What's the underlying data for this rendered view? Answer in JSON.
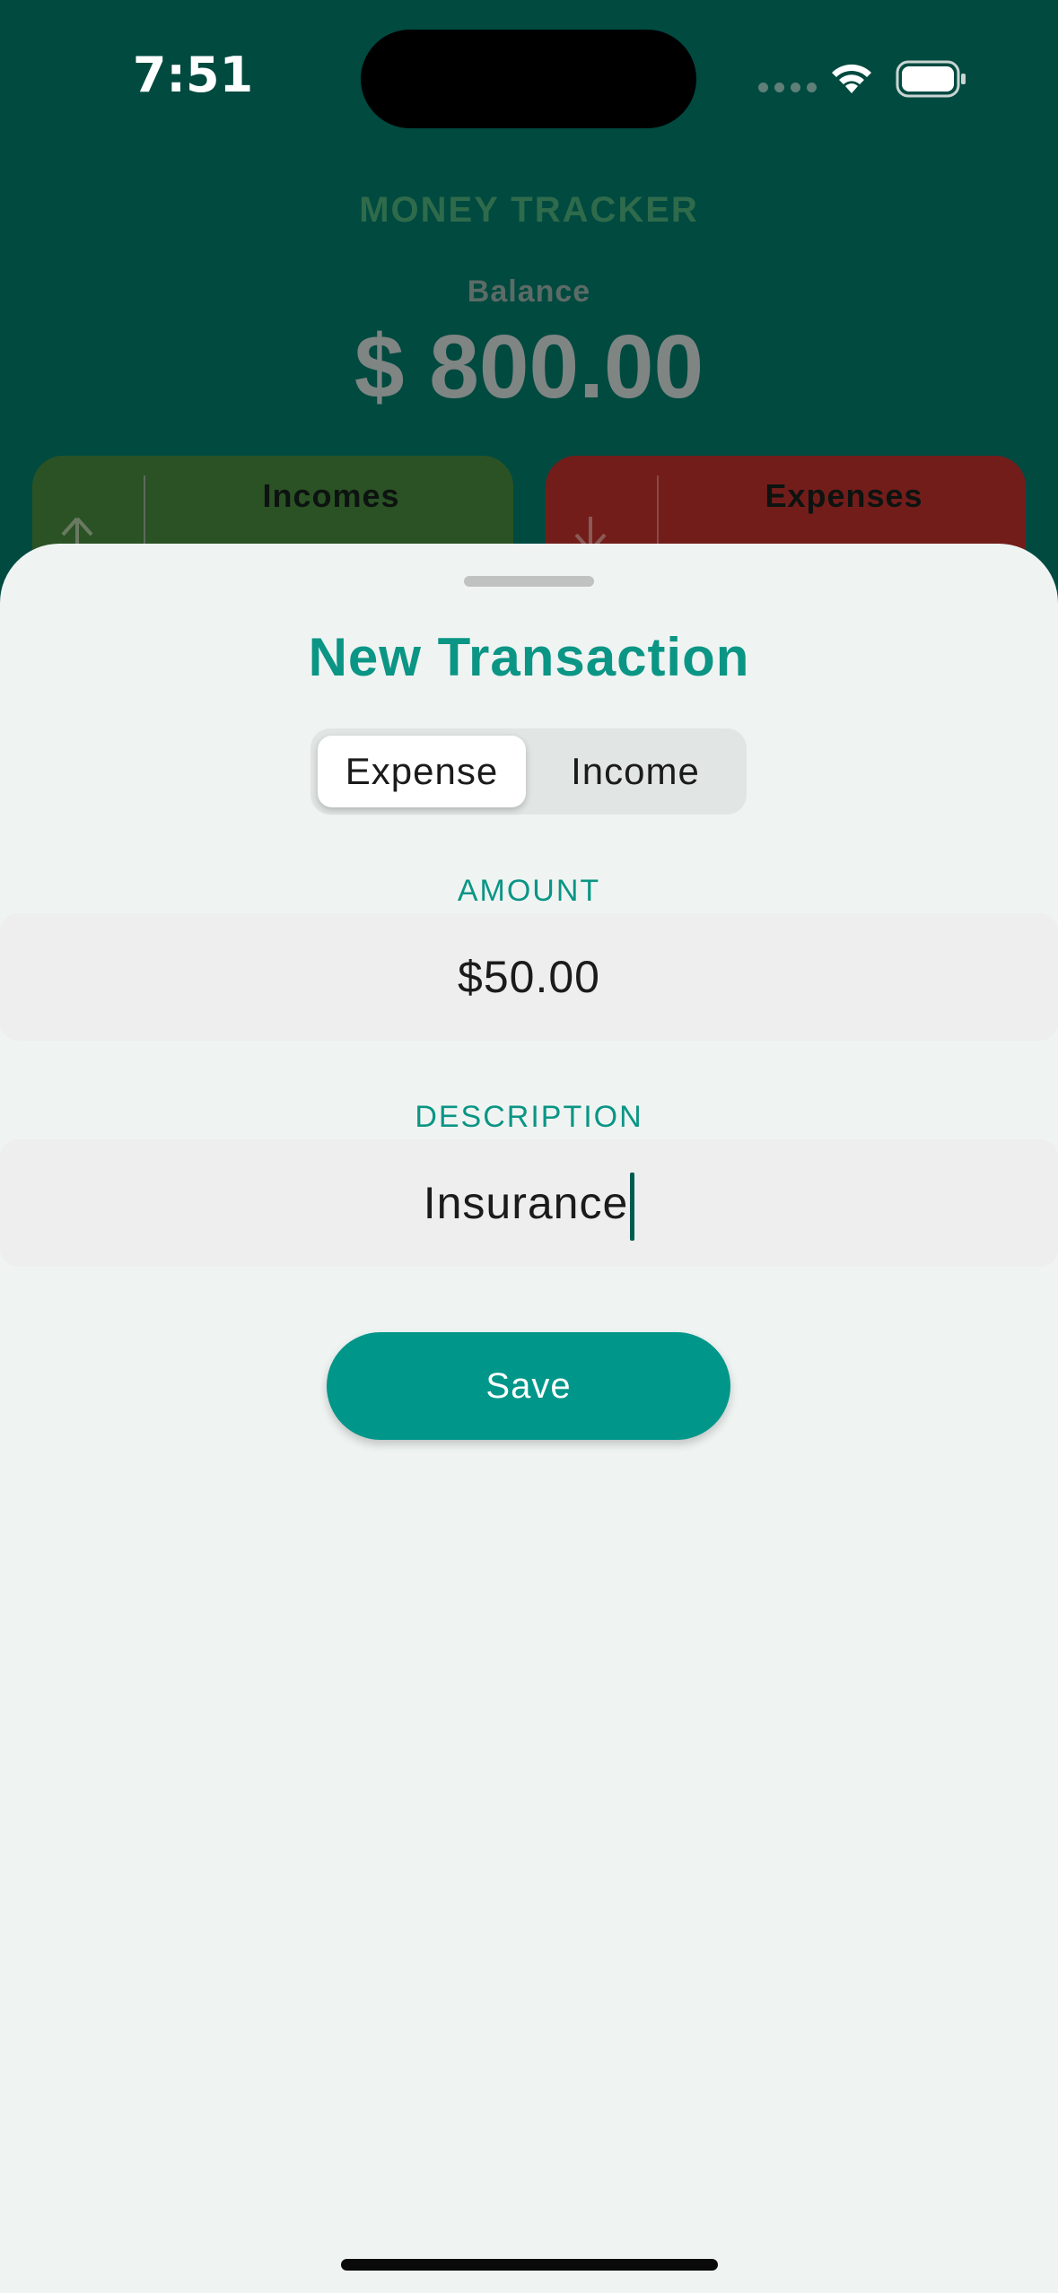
{
  "status_bar": {
    "time": "7:51",
    "icons": [
      "signal-dots-icon",
      "wifi-icon",
      "battery-icon"
    ]
  },
  "background_screen": {
    "app_title": "MONEY TRACKER",
    "balance_label": "Balance",
    "balance_value": "$ 800.00",
    "cards": {
      "incomes_label": "Incomes",
      "expenses_label": "Expenses"
    }
  },
  "sheet": {
    "title": "New Transaction",
    "segments": [
      "Expense",
      "Income"
    ],
    "selected_segment": "Expense",
    "amount": {
      "label": "AMOUNT",
      "value": "$50.00"
    },
    "description": {
      "label": "DESCRIPTION",
      "value": "Insurance"
    },
    "save_label": "Save"
  },
  "colors": {
    "accent": "#00968a",
    "header_bg": "#004a40",
    "income_card": "#2b5225",
    "expense_card": "#731d1b",
    "sheet_bg": "#eff4f2"
  }
}
